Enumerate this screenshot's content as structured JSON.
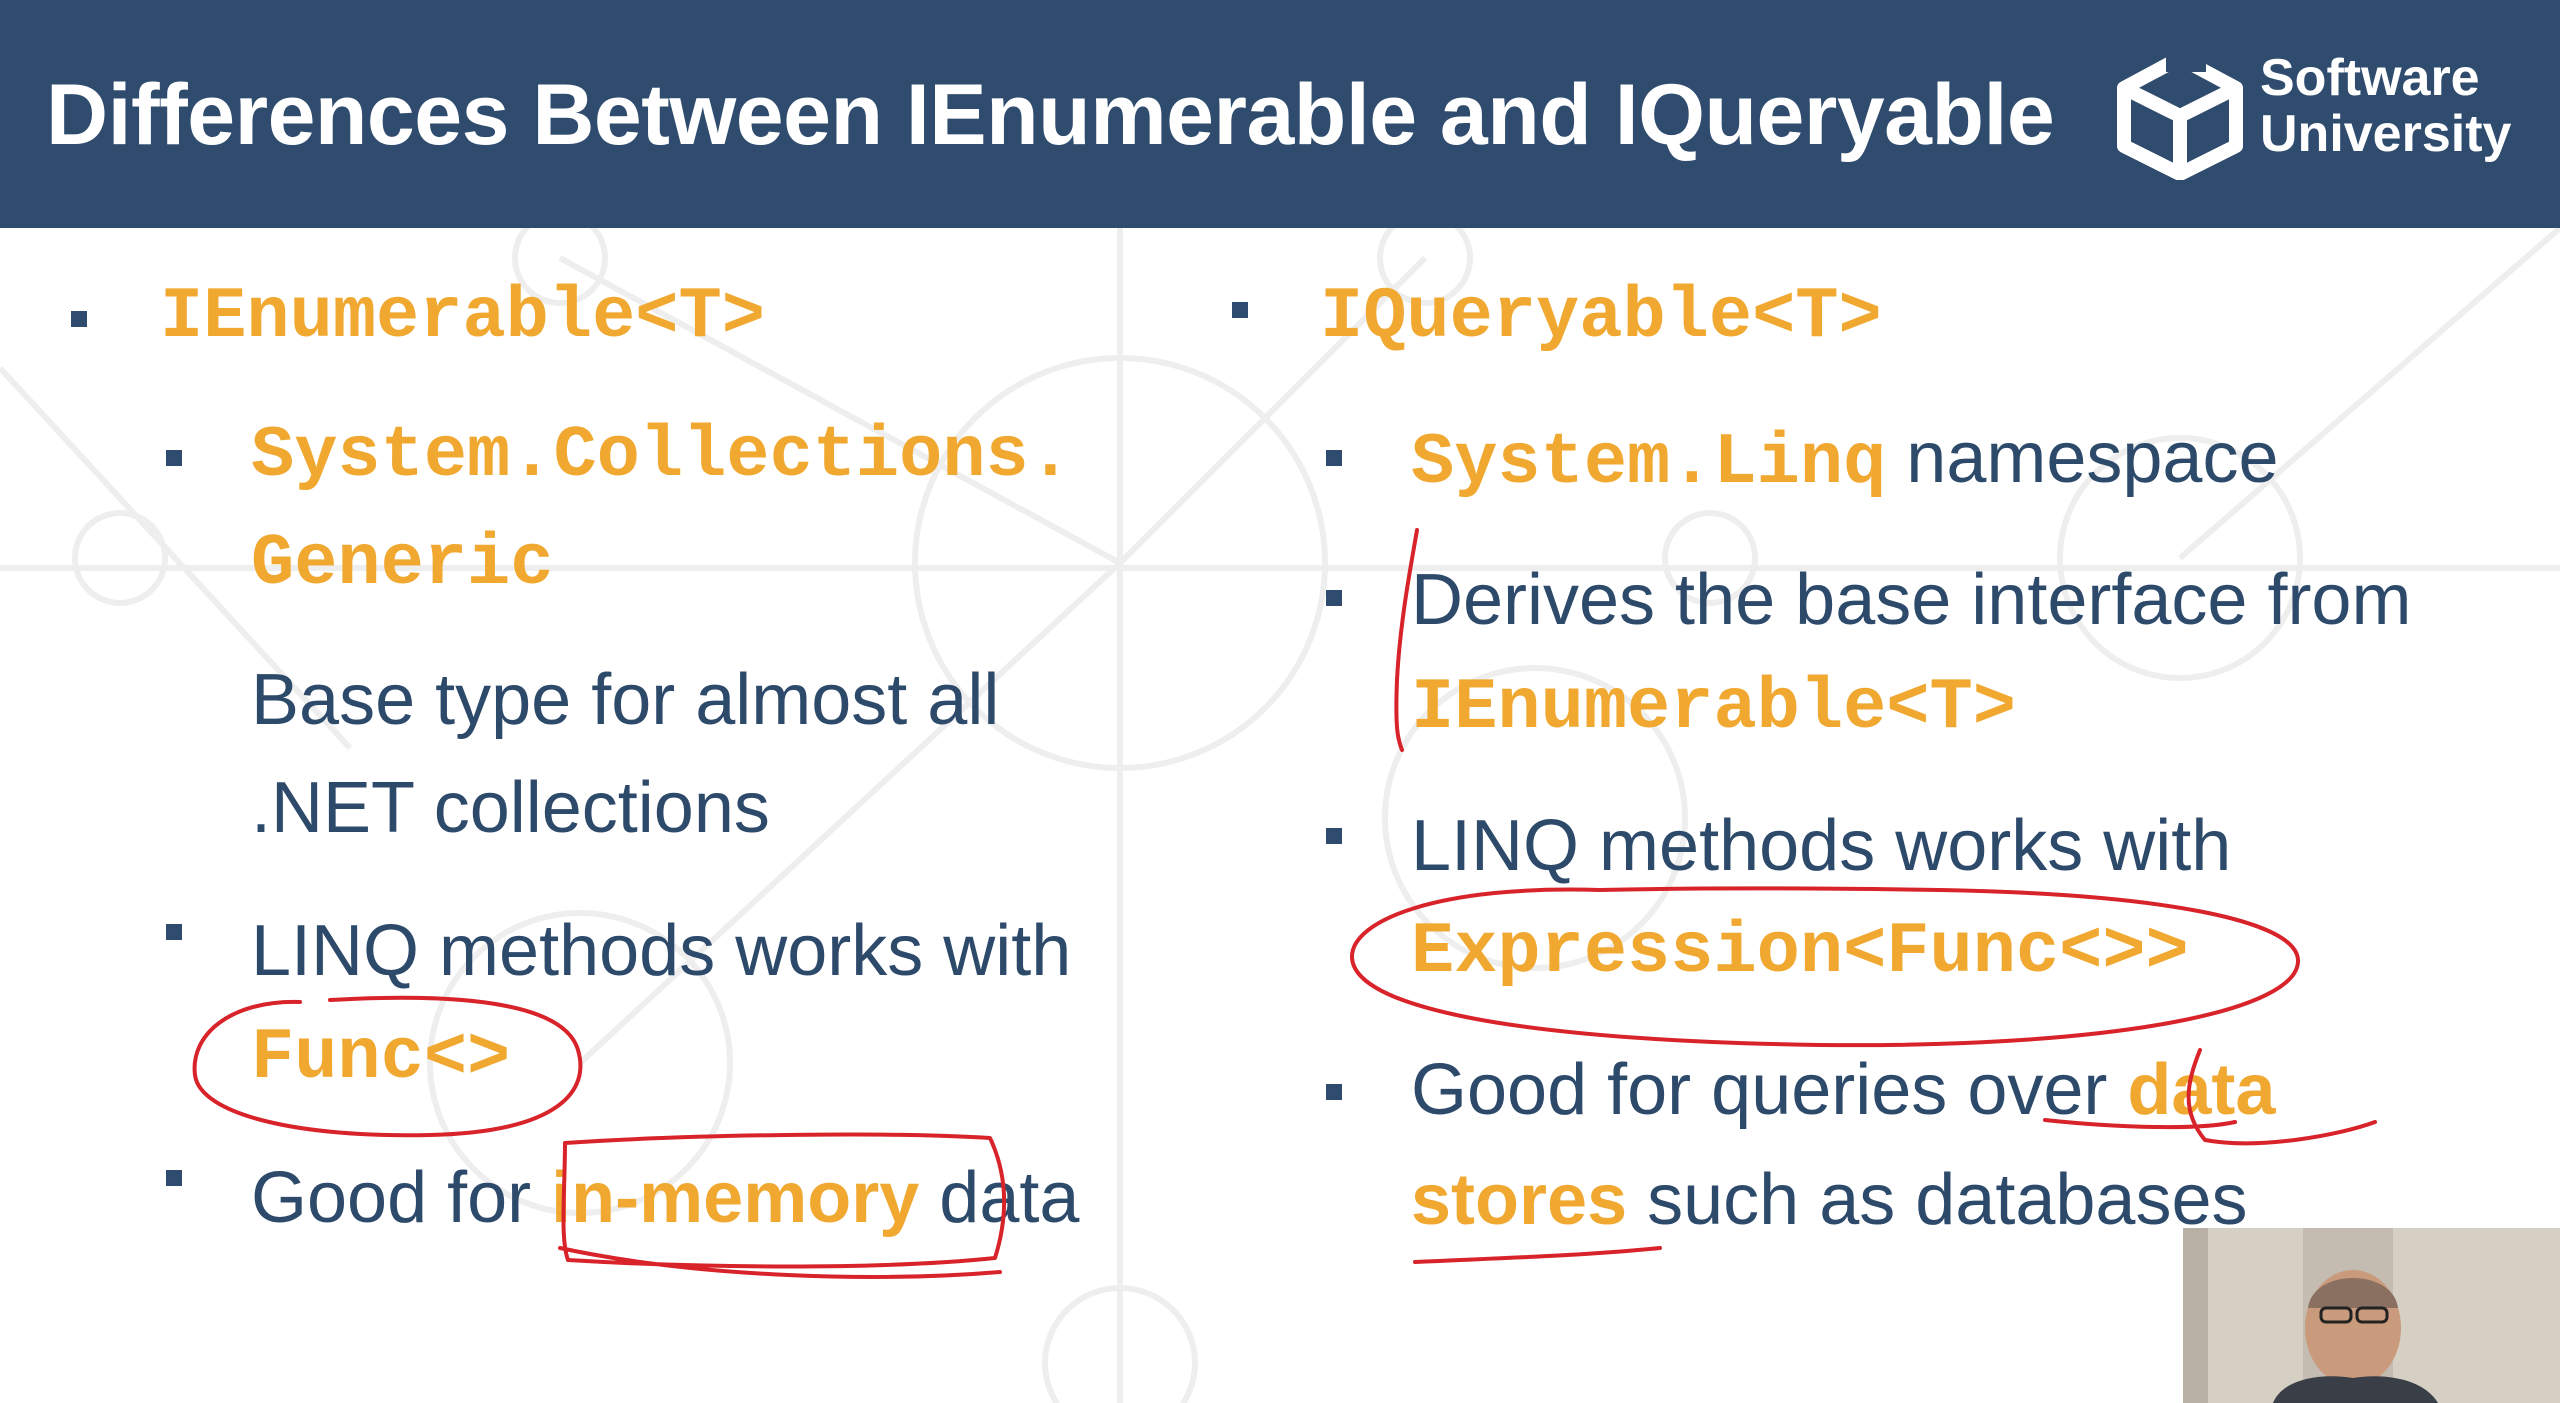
{
  "header": {
    "title": "Differences Between IEnumerable and IQueryable"
  },
  "logo": {
    "line1": "Software",
    "line2": "University",
    "icon": "softuni-cube-icon"
  },
  "left": {
    "heading": "IEnumerable<T>",
    "items": [
      {
        "code1": "System.Collections.",
        "code2": "Generic"
      },
      {
        "text1": "Base type for almost all",
        "text2": ".NET collections"
      },
      {
        "text1": "LINQ methods works with",
        "code2": "Func<>"
      },
      {
        "pre": "Good for ",
        "highlight": "in-memory",
        "post": " data"
      }
    ]
  },
  "right": {
    "heading": "IQueryable<T>",
    "items": [
      {
        "code": "System.Linq",
        "text": " namespace"
      },
      {
        "text1": "Derives the base interface from",
        "code2": "IEnumerable<T>"
      },
      {
        "text1": "LINQ methods works with",
        "code2": "Expression<Func<>>"
      },
      {
        "pre": "Good for queries over ",
        "highlight1": "data",
        "highlight2": "stores",
        "post": " such as databases"
      }
    ]
  },
  "colors": {
    "header_bg": "#2f4b6e",
    "accent": "#f0a830",
    "text": "#2d4a6b",
    "ink": "#d8232a"
  }
}
